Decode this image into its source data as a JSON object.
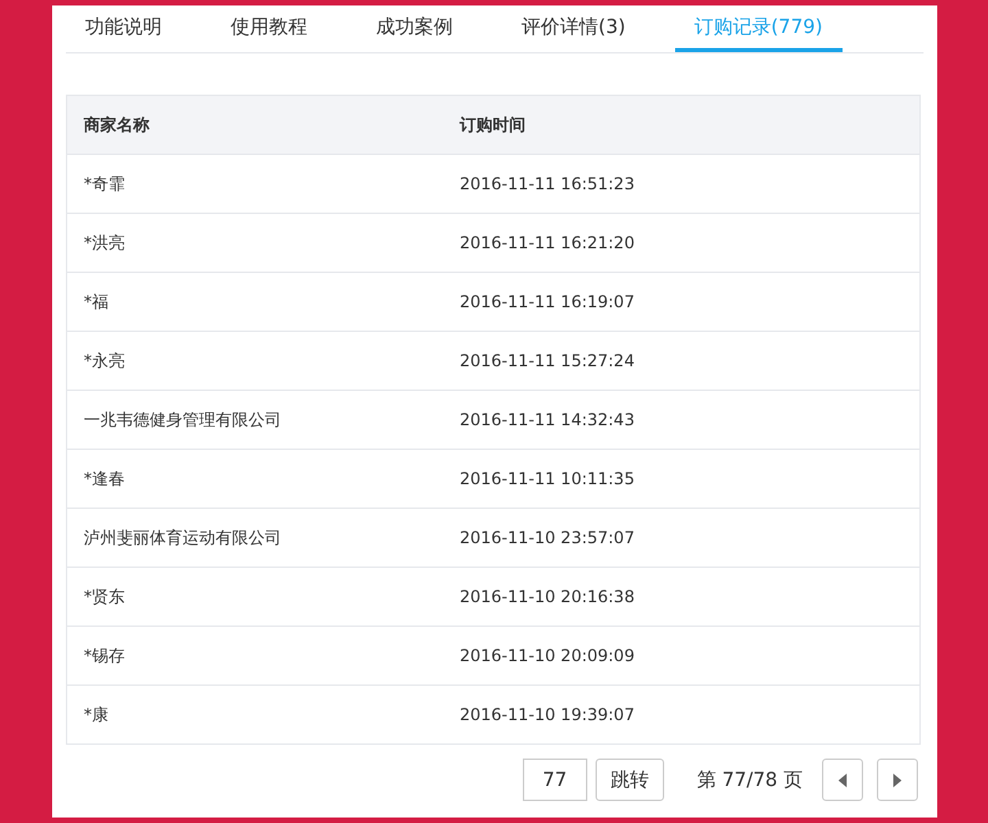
{
  "tabs": [
    {
      "label": "功能说明",
      "selected": false
    },
    {
      "label": "使用教程",
      "selected": false
    },
    {
      "label": "成功案例",
      "selected": false
    },
    {
      "label": "评价详情(3)",
      "selected": false
    },
    {
      "label": "订购记录(779)",
      "selected": true
    }
  ],
  "table": {
    "columns": [
      "商家名称",
      "订购时间"
    ],
    "rows": [
      [
        "*奇霏",
        "2016-11-11 16:51:23"
      ],
      [
        "*洪亮",
        "2016-11-11 16:21:20"
      ],
      [
        "*福",
        "2016-11-11 16:19:07"
      ],
      [
        "*永亮",
        "2016-11-11 15:27:24"
      ],
      [
        "一兆韦德健身管理有限公司",
        "2016-11-11 14:32:43"
      ],
      [
        "*逢春",
        "2016-11-11 10:11:35"
      ],
      [
        "泸州斐丽体育运动有限公司",
        "2016-11-10 23:57:07"
      ],
      [
        "*贤东",
        "2016-11-10 20:16:38"
      ],
      [
        "*锡存",
        "2016-11-10 20:09:09"
      ],
      [
        "*康",
        "2016-11-10 19:39:07"
      ]
    ]
  },
  "pagination": {
    "page_input": "77",
    "jump_button": "跳转",
    "page_info": "第 77/78 页"
  }
}
